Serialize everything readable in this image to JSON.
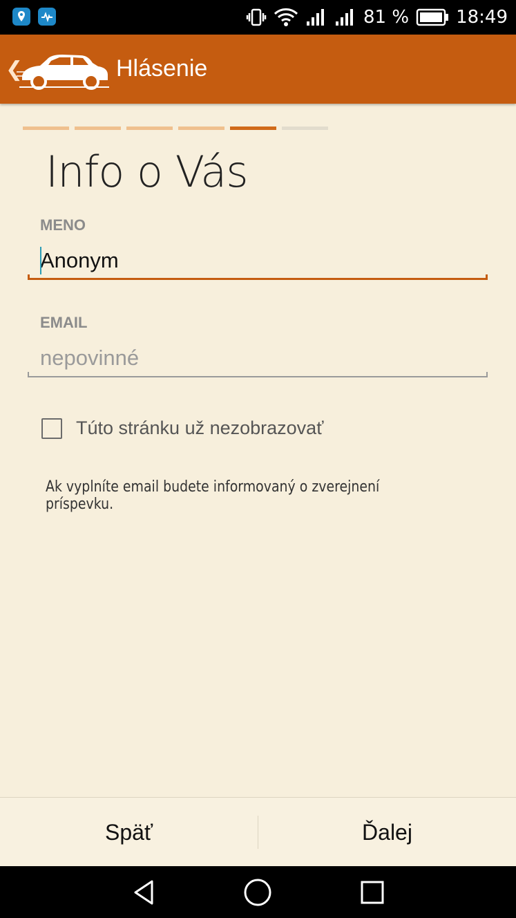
{
  "status_bar": {
    "battery": "81 %",
    "time": "18:49",
    "icons": [
      "maps-app-icon",
      "health-app-icon",
      "vibrate-icon",
      "wifi-icon",
      "signal-icon",
      "signal-icon",
      "battery-icon"
    ]
  },
  "app_bar": {
    "title": "Hlásenie",
    "back_icon": "chevron-left-icon",
    "logo_icon": "vintage-car-icon",
    "color": "#c55c10"
  },
  "progress": {
    "total_steps": 6,
    "current_step": 5
  },
  "page_title": "Info o Vás",
  "fields": {
    "name": {
      "label": "MENO",
      "value": "Anonym"
    },
    "email": {
      "label": "EMAIL",
      "value": "",
      "placeholder": "nepovinné"
    }
  },
  "checkbox": {
    "label": "Túto stránku už nezobrazovať",
    "checked": false
  },
  "info_text": "Ak vyplníte email budete informovaný o zverejnení príspevku.",
  "actions": {
    "back_label": "Späť",
    "next_label": "Ďalej"
  },
  "nav_bar": {
    "icons": [
      "back-triangle-icon",
      "home-circle-icon",
      "recents-square-icon"
    ]
  }
}
